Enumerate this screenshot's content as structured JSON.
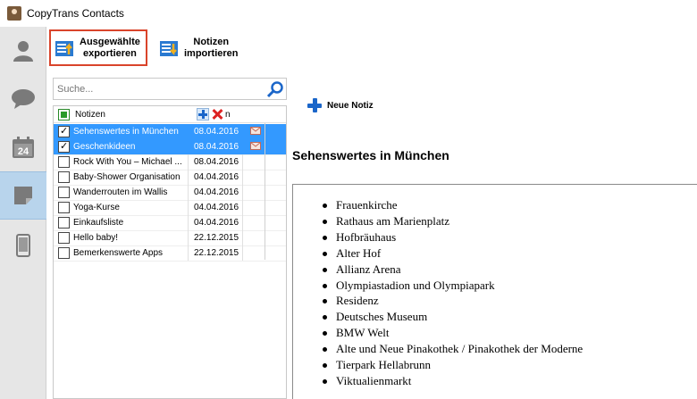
{
  "window": {
    "title": "CopyTrans Contacts"
  },
  "sidebar": {
    "items": [
      {
        "icon": "contacts-icon"
      },
      {
        "icon": "messages-icon"
      },
      {
        "icon": "calendar-icon",
        "label": "24"
      },
      {
        "icon": "notes-icon",
        "active": true
      },
      {
        "icon": "phone-icon"
      }
    ]
  },
  "toolbar": {
    "export_label_1": "Ausgewählte",
    "export_label_2": "exportieren",
    "import_label_1": "Notizen",
    "import_label_2": "importieren"
  },
  "search": {
    "placeholder": "Suche..."
  },
  "list": {
    "header_label": "Notizen",
    "header_col2_fragment": "n",
    "rows": [
      {
        "name": "Sehenswertes in München",
        "date": "08.04.2016",
        "checked": true,
        "selected": true,
        "mail": true
      },
      {
        "name": "Geschenkideen",
        "date": "08.04.2016",
        "checked": true,
        "selected": true,
        "mail": true
      },
      {
        "name": "Rock With You – Michael ...",
        "date": "08.04.2016",
        "checked": false,
        "selected": false
      },
      {
        "name": "Baby-Shower Organisation",
        "date": "04.04.2016",
        "checked": false,
        "selected": false
      },
      {
        "name": "Wanderrouten im Wallis",
        "date": "04.04.2016",
        "checked": false,
        "selected": false
      },
      {
        "name": "Yoga-Kurse",
        "date": "04.04.2016",
        "checked": false,
        "selected": false
      },
      {
        "name": "Einkaufsliste",
        "date": "04.04.2016",
        "checked": false,
        "selected": false
      },
      {
        "name": "Hello baby!",
        "date": "22.12.2015",
        "checked": false,
        "selected": false
      },
      {
        "name": "Bemerkenswerte Apps",
        "date": "22.12.2015",
        "checked": false,
        "selected": false
      }
    ]
  },
  "editor": {
    "new_note_label": "Neue Notiz",
    "title": "Sehenswertes in München",
    "items": [
      "Frauenkirche",
      "Rathaus am Marienplatz",
      "Hofbräuhaus",
      "Alter Hof",
      "Allianz Arena",
      "Olympiastadion und Olympiapark",
      "Residenz",
      "Deutsches Museum",
      "BMW Welt",
      "Alte und Neue Pinakothek / Pinakothek der Moderne",
      "Tierpark Hellabrunn",
      "Viktualienmarkt"
    ]
  },
  "colors": {
    "selection": "#3399ff",
    "accent_blue": "#1b66c9",
    "highlight_border": "#d9442b",
    "sidebar_active": "#b8d4ec"
  }
}
